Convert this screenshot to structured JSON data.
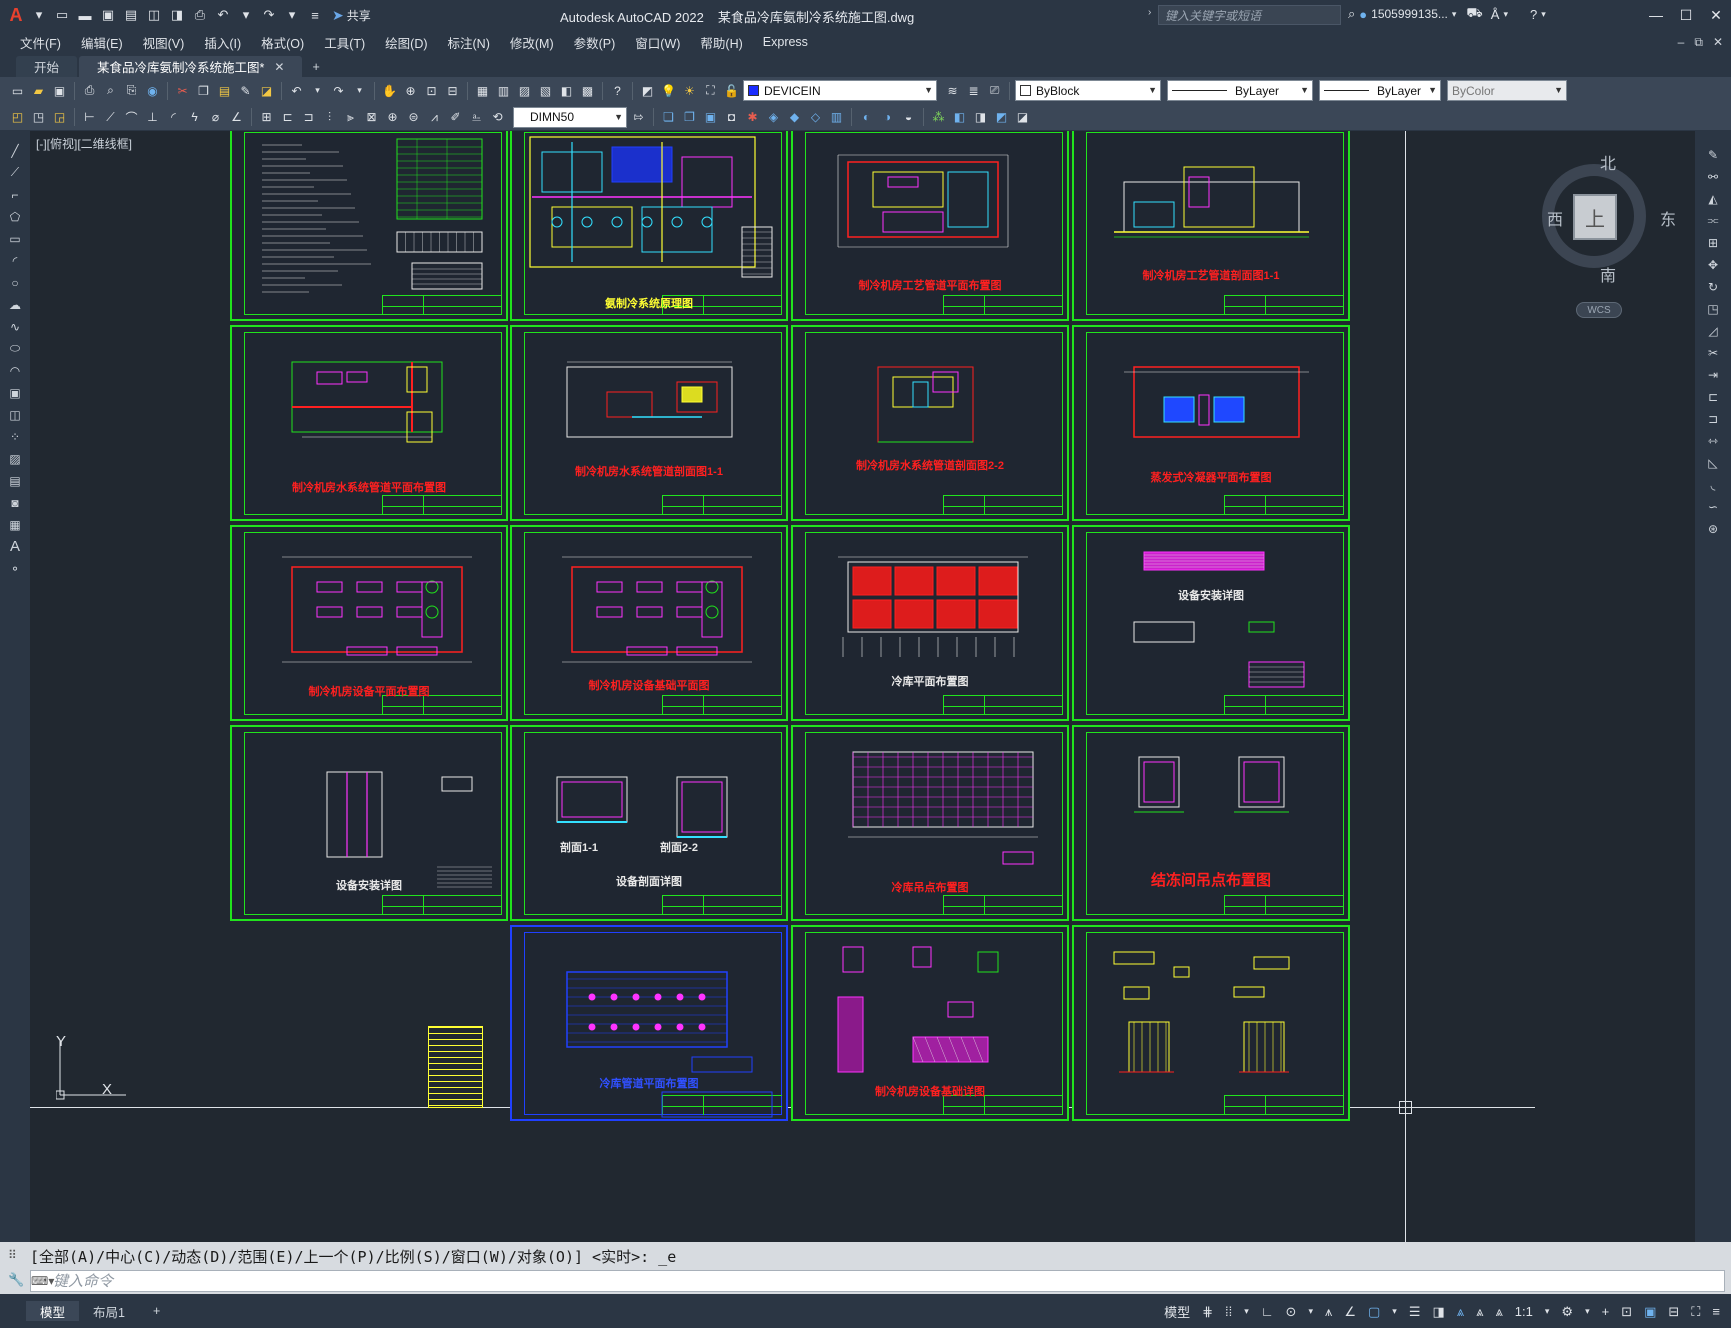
{
  "titlebar": {
    "app": "Autodesk AutoCAD 2022",
    "document": "某食品冷库氨制冷系统施工图.dwg",
    "share_label": "共享",
    "search_placeholder": "键入关键字或短语",
    "user": "1505999135..."
  },
  "menu": [
    "文件(F)",
    "编辑(E)",
    "视图(V)",
    "插入(I)",
    "格式(O)",
    "工具(T)",
    "绘图(D)",
    "标注(N)",
    "修改(M)",
    "参数(P)",
    "窗口(W)",
    "帮助(H)",
    "Express"
  ],
  "tabs": {
    "start": "开始",
    "active": "某食品冷库氨制冷系统施工图*"
  },
  "toolbar": {
    "layer": "DEVICEIN",
    "color": "ByBlock",
    "linetype": "ByLayer",
    "lineweight": "ByLayer",
    "plotstyle": "ByColor",
    "dimstyle": "DIMN50",
    "colors": {
      "layer_swatch": "#1a2cff"
    }
  },
  "viewport": {
    "label": "[-][俯视][二维线框]",
    "viewcube": {
      "north": "北",
      "south": "南",
      "east": "东",
      "west": "西",
      "face": "上",
      "wcs": "WCS"
    },
    "ucs": {
      "x": "X",
      "y": "Y"
    }
  },
  "sheets": {
    "s2": "氨制冷系统原理图",
    "s3": "制冷机房工艺管道平面布置图",
    "s4": "制冷机房工艺管道剖面图1-1",
    "s5": "制冷机房水系统管道平面布置图",
    "s6": "制冷机房水系统管道剖面图1-1",
    "s7": "制冷机房水系统管道剖面图2-2",
    "s8": "蒸发式冷凝器平面布置图",
    "s9": "制冷机房设备平面布置图",
    "s10": "制冷机房设备基础平面图",
    "s11": "冷库平面布置图",
    "s12": "设备安装详图",
    "s13": "设备安装详图",
    "s14": "设备剖面详图",
    "s14a": "剖面1-1",
    "s14b": "剖面2-2",
    "s15": "冷库吊点布置图",
    "s16": "结冻间吊点布置图",
    "s18": "冷库管道平面布置图",
    "s19": "制冷机房设备基础详图"
  },
  "command": {
    "history": "[全部(A)/中心(C)/动态(D)/范围(E)/上一个(P)/比例(S)/窗口(W)/对象(O)] <实时>: _e",
    "placeholder": "键入命令"
  },
  "layout_tabs": [
    "模型",
    "布局1"
  ],
  "status": {
    "model": "模型",
    "scale": "1:1"
  },
  "colors": {
    "sheet_border": "#21e31d",
    "title_red": "#ff2020",
    "canvas_bg": "#212830"
  }
}
